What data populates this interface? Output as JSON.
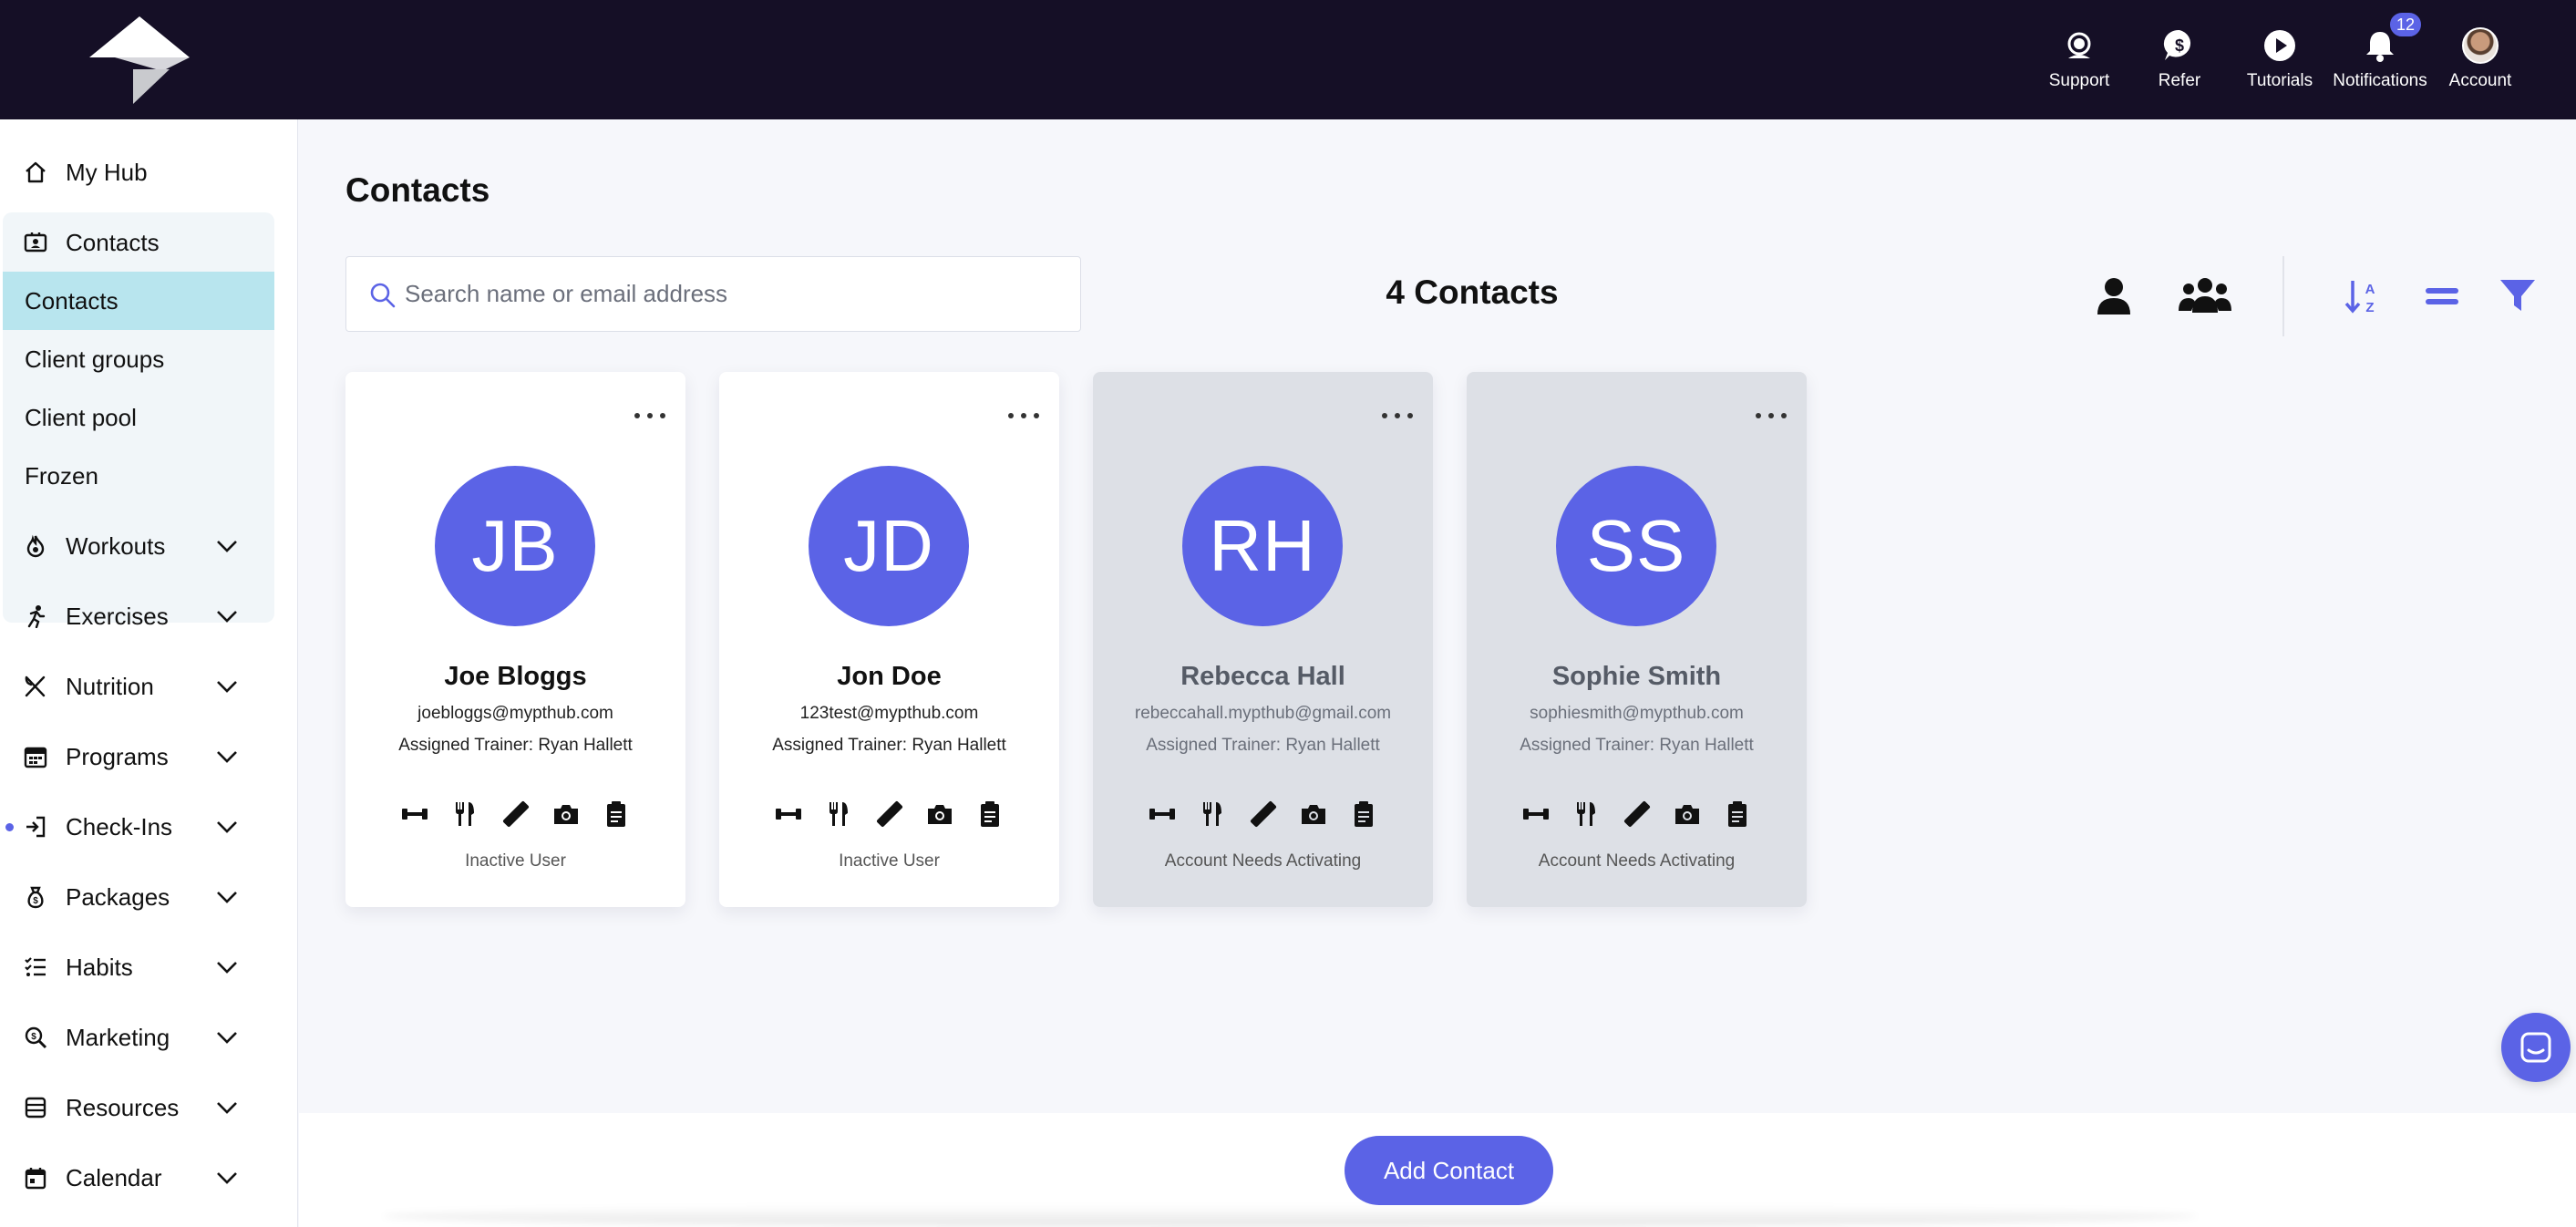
{
  "topbar": {
    "items": [
      {
        "label": "Support",
        "icon": "support-icon"
      },
      {
        "label": "Refer",
        "icon": "dollar-icon"
      },
      {
        "label": "Tutorials",
        "icon": "play-icon"
      },
      {
        "label": "Notifications",
        "icon": "bell-icon",
        "badge": "12"
      },
      {
        "label": "Account",
        "icon": "avatar"
      }
    ]
  },
  "sidebar": {
    "items": [
      {
        "label": "My Hub",
        "icon": "home-icon"
      },
      {
        "label": "Contacts",
        "icon": "contacts-icon"
      },
      {
        "label": "Workouts",
        "icon": "flame-icon"
      },
      {
        "label": "Exercises",
        "icon": "running-icon"
      },
      {
        "label": "Nutrition",
        "icon": "utensils-icon"
      },
      {
        "label": "Programs",
        "icon": "calendar-grid-icon"
      },
      {
        "label": "Check-Ins",
        "icon": "sign-in-icon"
      },
      {
        "label": "Packages",
        "icon": "money-bag-icon"
      },
      {
        "label": "Habits",
        "icon": "checklist-icon"
      },
      {
        "label": "Marketing",
        "icon": "search-dollar-icon"
      },
      {
        "label": "Resources",
        "icon": "archive-icon"
      },
      {
        "label": "Calendar",
        "icon": "calendar-icon"
      }
    ],
    "contacts_sub": [
      "Contacts",
      "Client groups",
      "Client pool",
      "Frozen"
    ]
  },
  "main": {
    "title": "Contacts",
    "search_placeholder": "Search name or email address",
    "count_label": "4 Contacts"
  },
  "contacts": [
    {
      "initials": "JB",
      "name": "Joe Bloggs",
      "email": "joebloggs@mypthub.com",
      "trainer": "Assigned Trainer: Ryan Hallett",
      "status": "Inactive User"
    },
    {
      "initials": "JD",
      "name": "Jon Doe",
      "email": "123test@mypthub.com",
      "trainer": "Assigned Trainer: Ryan Hallett",
      "status": "Inactive User"
    },
    {
      "initials": "RH",
      "name": "Rebecca Hall",
      "email": "rebeccahall.mypthub@gmail.com",
      "trainer": "Assigned Trainer: Ryan Hallett",
      "status": "Account Needs Activating"
    },
    {
      "initials": "SS",
      "name": "Sophie Smith",
      "email": "sophiesmith@mypthub.com",
      "trainer": "Assigned Trainer: Ryan Hallett",
      "status": "Account Needs Activating"
    }
  ],
  "footer": {
    "add_label": "Add Contact"
  },
  "colors": {
    "accent": "#5b63e6",
    "topbar": "#150f26",
    "active_sub": "#b8e5ee"
  }
}
